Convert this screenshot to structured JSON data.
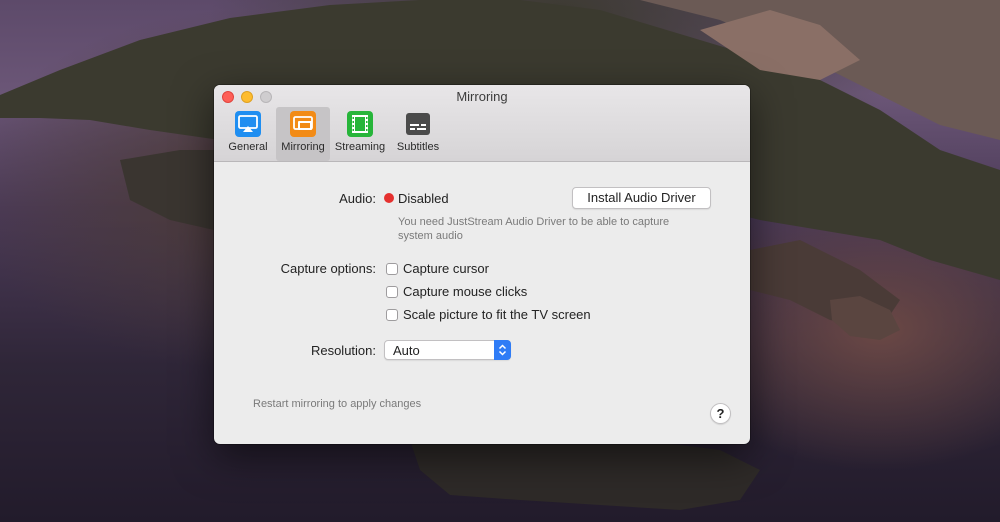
{
  "window": {
    "title": "Mirroring"
  },
  "toolbar": {
    "items": [
      {
        "label": "General",
        "icon": "general-icon",
        "active": false
      },
      {
        "label": "Mirroring",
        "icon": "mirroring-icon",
        "active": true
      },
      {
        "label": "Streaming",
        "icon": "streaming-icon",
        "active": false
      },
      {
        "label": "Subtitles",
        "icon": "subtitles-icon",
        "active": false
      }
    ]
  },
  "audio": {
    "label": "Audio:",
    "status": "Disabled",
    "status_color": "#e5312f",
    "install_button": "Install Audio Driver",
    "hint_line1": "You need JustStream Audio Driver to be able to capture",
    "hint_line2": "system audio"
  },
  "capture": {
    "label": "Capture options:",
    "options": [
      {
        "label": "Capture cursor",
        "checked": false
      },
      {
        "label": "Capture mouse clicks",
        "checked": false
      },
      {
        "label": "Scale picture to fit the TV screen",
        "checked": false
      }
    ]
  },
  "resolution": {
    "label": "Resolution:",
    "value": "Auto"
  },
  "footer": {
    "note": "Restart mirroring to apply changes",
    "help": "?"
  },
  "colors": {
    "accent": "#2f7cf6",
    "general_icon": "#1f8ef1",
    "mirroring_icon": "#f28b16",
    "streaming_icon": "#27b53a",
    "subtitles_icon": "#4b4b4b"
  }
}
